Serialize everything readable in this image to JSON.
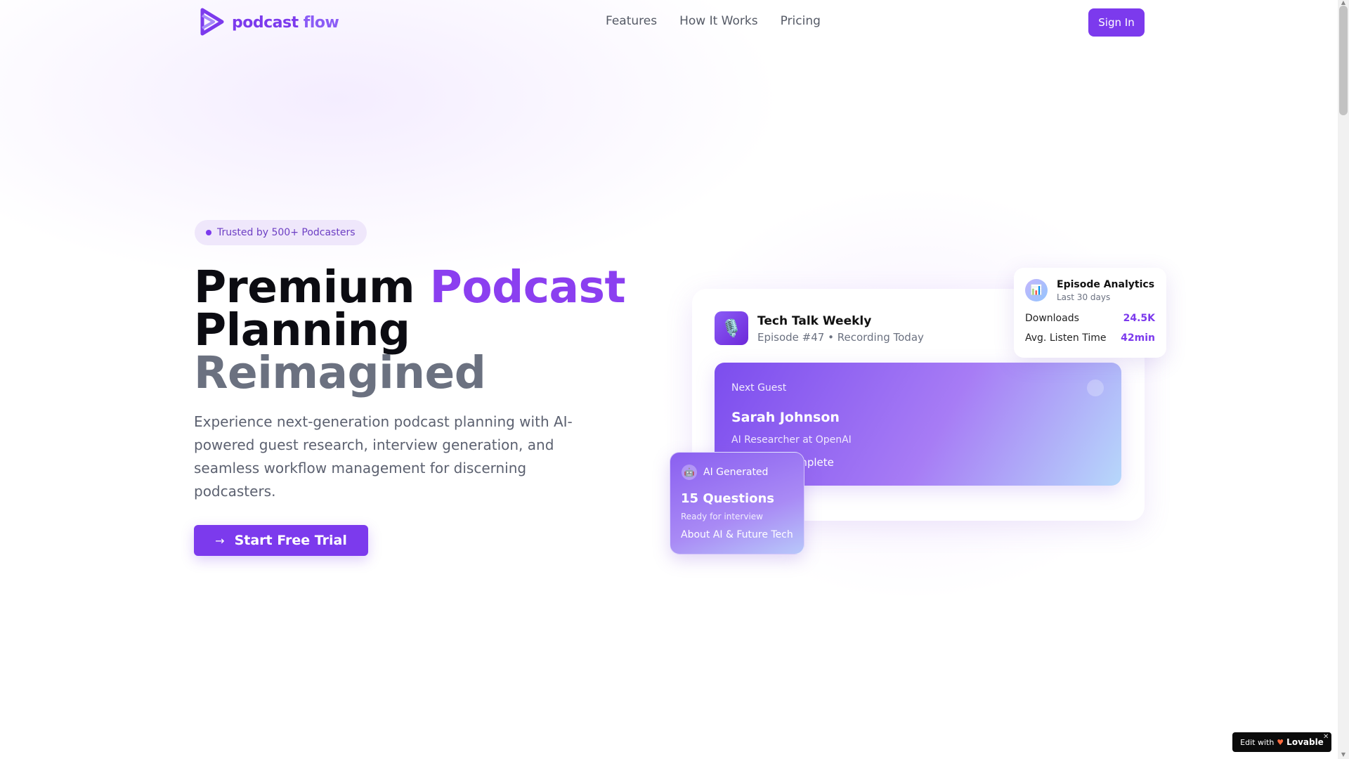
{
  "header": {
    "logo": {
      "word1": "podcast",
      "word2": "flow"
    },
    "nav": [
      "Features",
      "How It Works",
      "Pricing"
    ],
    "signin_label": "Sign In"
  },
  "hero": {
    "badge": "Trusted by 500+ Podcasters",
    "headline": {
      "line1_a": "Premium ",
      "line1_b": "Podcast",
      "line2": "Planning",
      "line3": "Reimagined"
    },
    "subtext": "Experience next-generation podcast planning with AI-powered guest research, interview generation, and seamless workflow management for discerning podcasters.",
    "cta_label": "Start Free Trial"
  },
  "episode_card": {
    "icon": "microphone-icon",
    "title": "Tech Talk Weekly",
    "subtitle": "Episode #47 • Recording Today",
    "guest": {
      "label": "Next Guest",
      "name": "Sarah Johnson",
      "role": "AI Researcher at OpenAI",
      "status": "Research Complete"
    }
  },
  "ai_card": {
    "icon": "robot-icon",
    "label": "AI Generated",
    "count": "15 Questions",
    "status": "Ready for interview",
    "topic": "About AI & Future Tech"
  },
  "analytics_card": {
    "icon": "bar-chart-icon",
    "title": "Episode Analytics",
    "period": "Last 30 days",
    "rows": [
      {
        "label": "Downloads",
        "value": "24.5K"
      },
      {
        "label": "Avg. Listen Time",
        "value": "42min"
      }
    ]
  },
  "lovable_badge": {
    "prefix": "Edit with",
    "brand": "Lovable"
  },
  "colors": {
    "accent": "#7c3aed",
    "heading": "#0c0c12",
    "muted": "#6b7180"
  }
}
